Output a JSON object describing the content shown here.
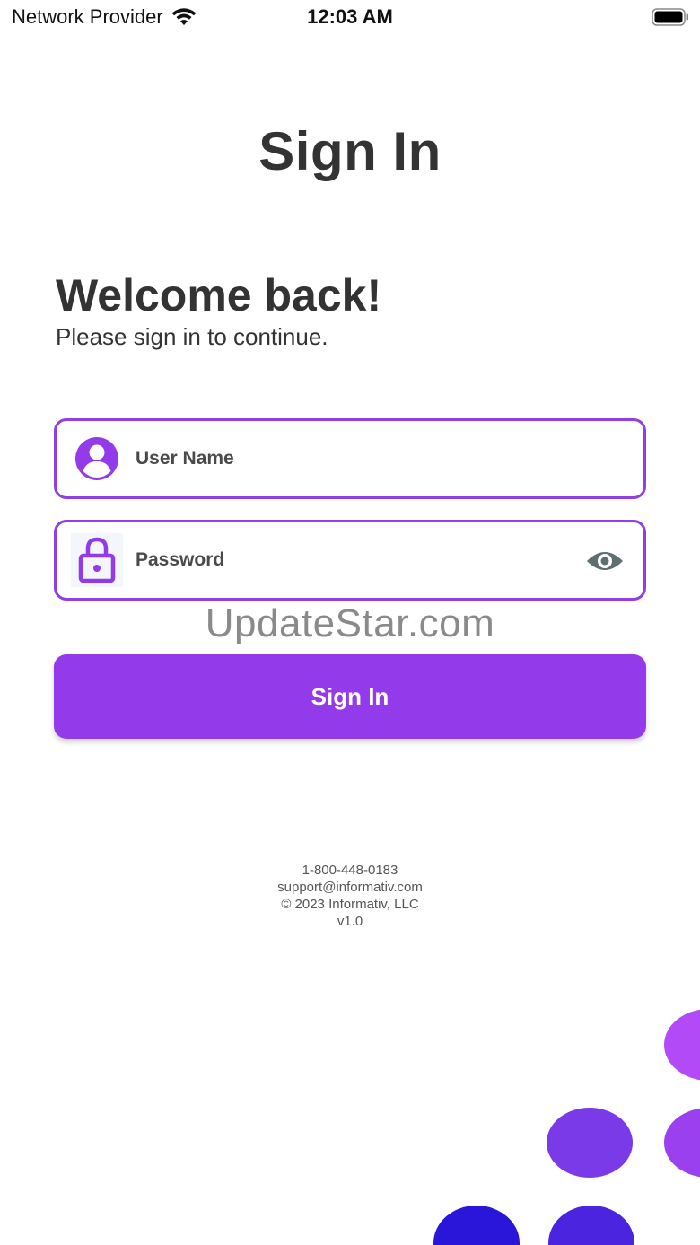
{
  "status_bar": {
    "carrier": "Network Provider",
    "time": "12:03 AM",
    "icons": [
      "wifi-icon",
      "battery-icon"
    ]
  },
  "page": {
    "title": "Sign In",
    "welcome": "Welcome back!",
    "subtitle": "Please sign in to continue."
  },
  "form": {
    "username": {
      "placeholder": "User Name",
      "value": "",
      "icon": "user-icon"
    },
    "password": {
      "placeholder": "Password",
      "value": "",
      "icon": "lock-icon",
      "toggle_icon": "eye-icon"
    },
    "submit_label": "Sign In"
  },
  "watermark": "UpdateStar.com",
  "footer": {
    "phone": "1-800-448-0183",
    "email": "support@informativ.com",
    "copyright": "© 2023 Informativ, LLC",
    "version": "v1.0"
  },
  "colors": {
    "accent": "#933bea",
    "field_border": "#8f3fe8",
    "text": "#333333",
    "eye_icon": "#5f6f6f",
    "dot_colors": [
      "#b34af7",
      "#7b3ae8",
      "#2a16d8",
      "#4a24de"
    ]
  }
}
